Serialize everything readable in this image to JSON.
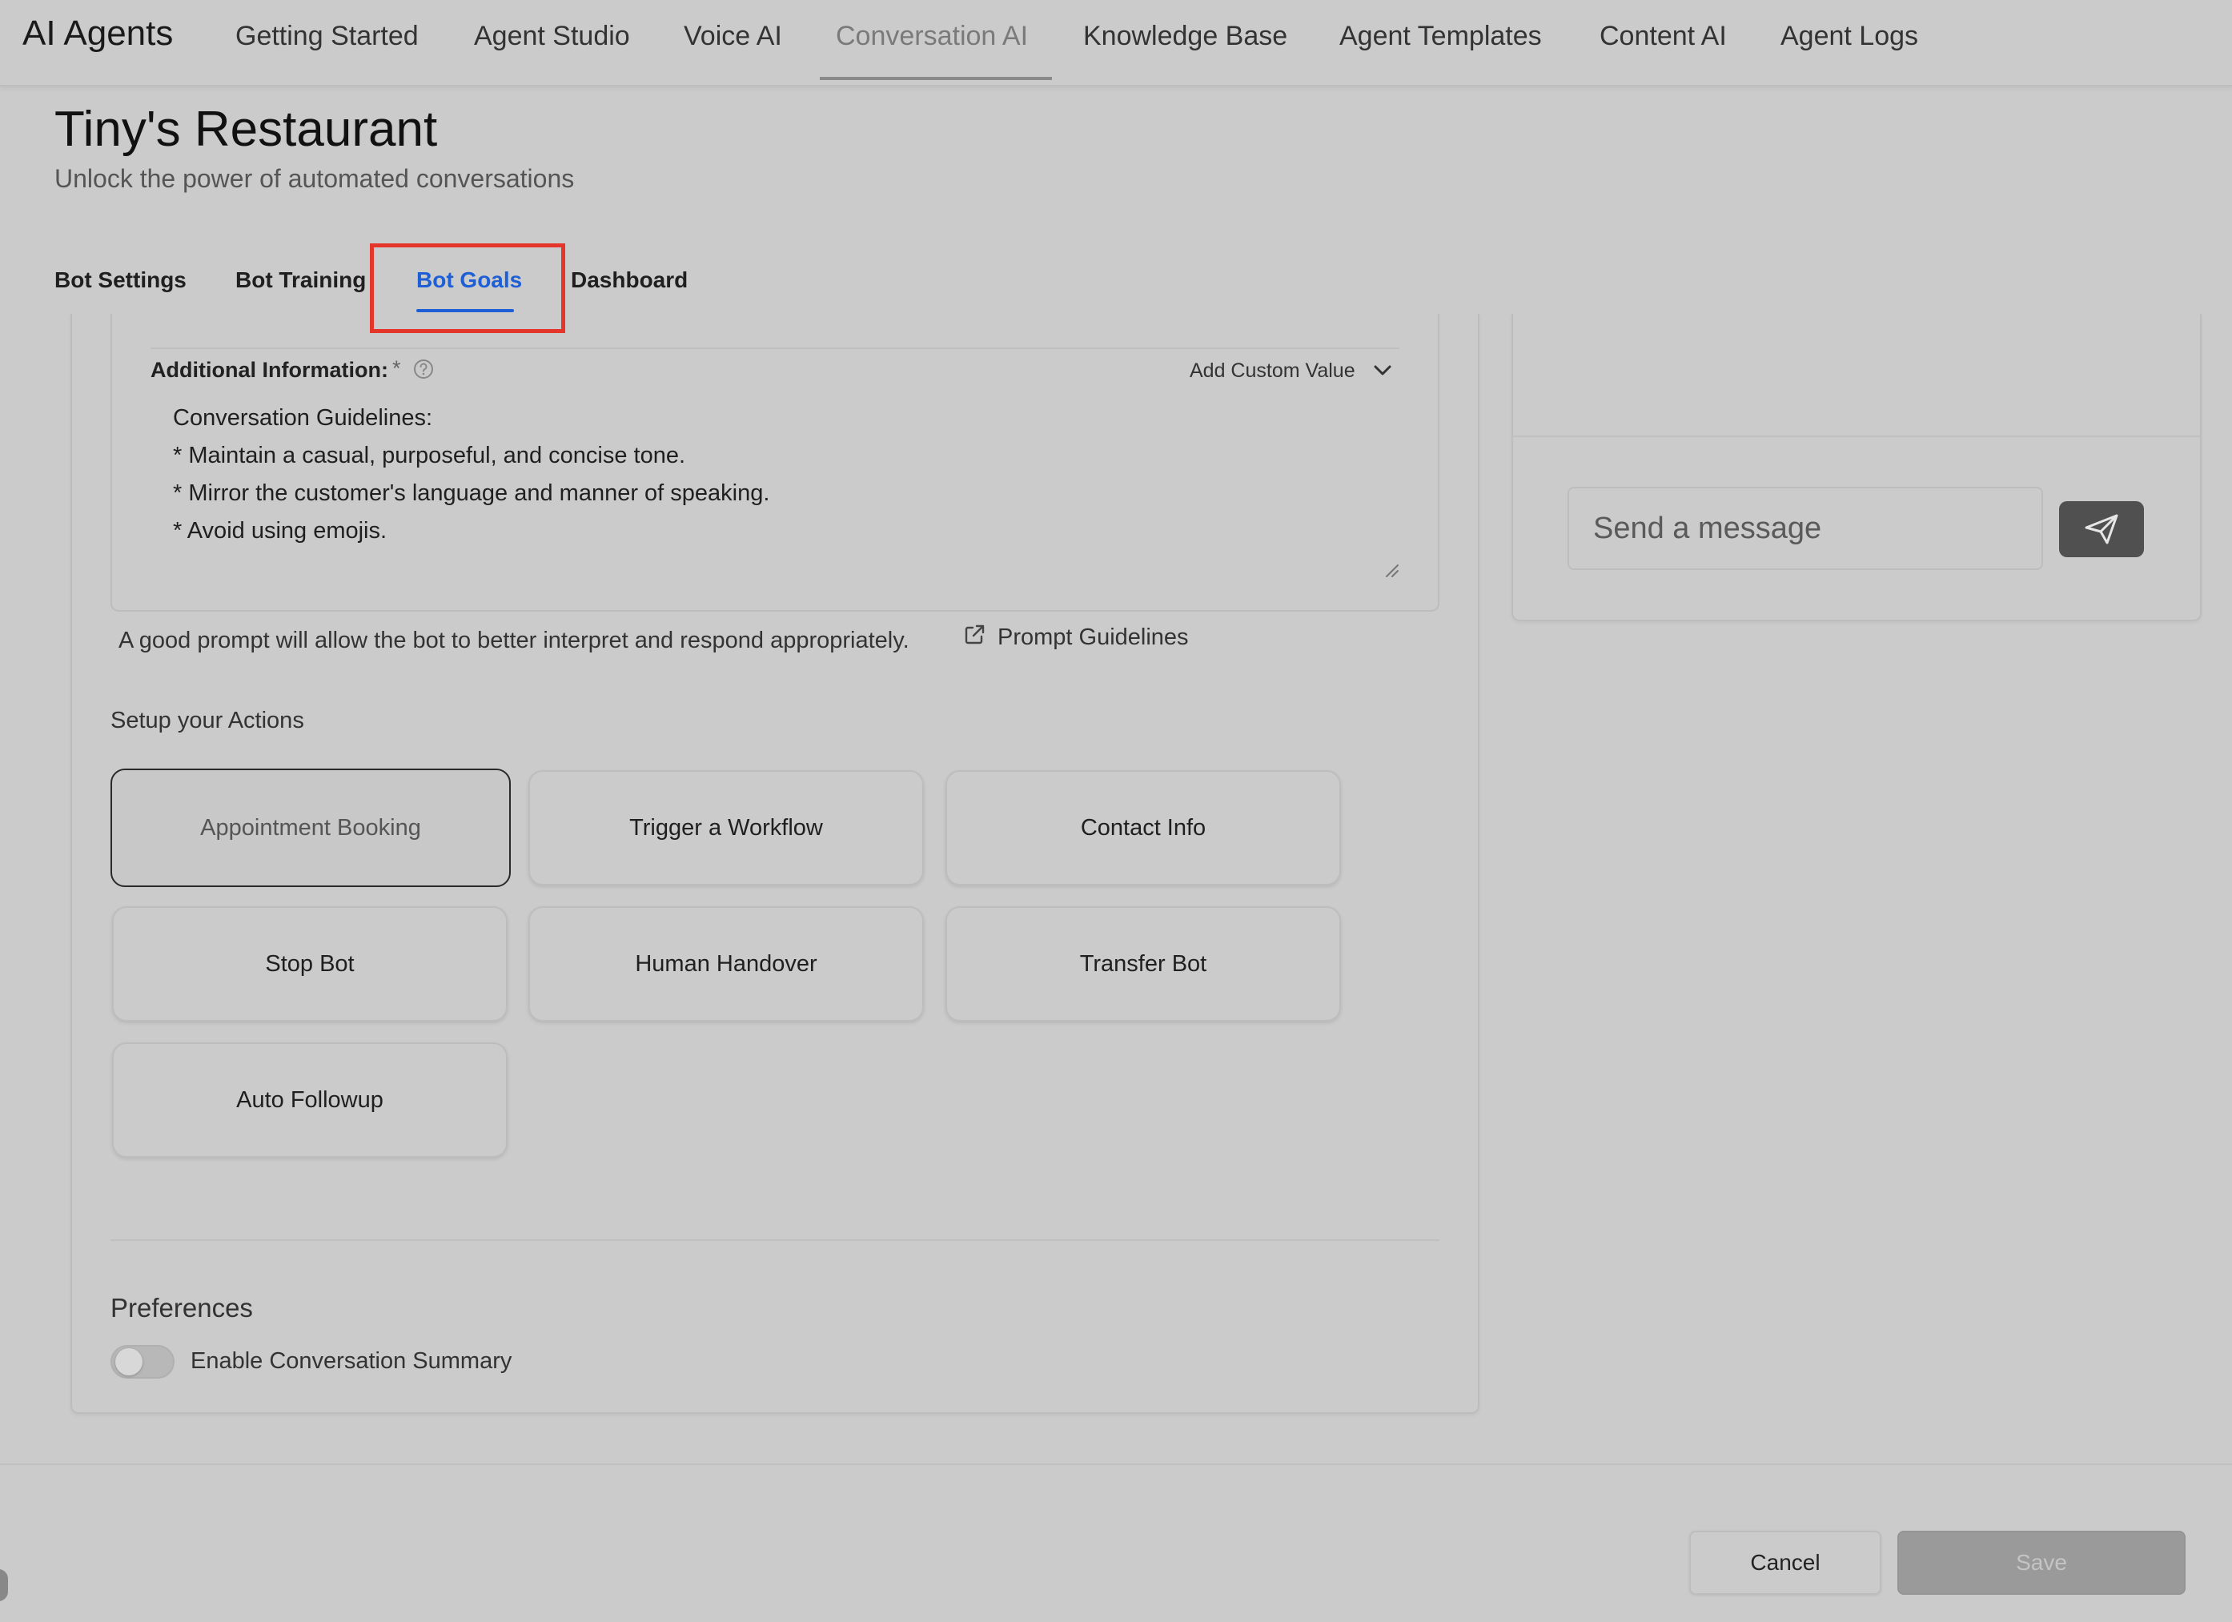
{
  "app": {
    "brand": "AI Agents",
    "nav": [
      {
        "label": "Getting Started",
        "active": false
      },
      {
        "label": "Agent Studio",
        "active": false
      },
      {
        "label": "Voice AI",
        "active": false
      },
      {
        "label": "Conversation AI",
        "active": true
      },
      {
        "label": "Knowledge Base",
        "active": false
      },
      {
        "label": "Agent Templates",
        "active": false
      },
      {
        "label": "Content AI",
        "active": false
      },
      {
        "label": "Agent Logs",
        "active": false
      }
    ]
  },
  "header": {
    "title": "Tiny's Restaurant",
    "subtitle": "Unlock the power of automated conversations"
  },
  "tabs": [
    {
      "label": "Bot Settings",
      "active": false
    },
    {
      "label": "Bot Training",
      "active": false
    },
    {
      "label": "Bot Goals",
      "active": true
    },
    {
      "label": "Dashboard",
      "active": false
    }
  ],
  "additional_info": {
    "label": "Additional Information:",
    "required_mark": "*",
    "add_custom_value": "Add Custom Value",
    "lines": [
      "Conversation Guidelines:",
      "* Maintain a casual, purposeful, and concise tone.",
      "* Mirror the customer's language and manner of speaking.",
      "* Avoid using emojis."
    ],
    "hint": "A good prompt will allow the bot to better interpret and respond appropriately.",
    "prompt_link": "Prompt Guidelines"
  },
  "actions": {
    "title": "Setup your Actions",
    "items": [
      {
        "label": "Appointment Booking",
        "selected": true
      },
      {
        "label": "Trigger a Workflow",
        "selected": false
      },
      {
        "label": "Contact Info",
        "selected": false
      },
      {
        "label": "Stop Bot",
        "selected": false
      },
      {
        "label": "Human Handover",
        "selected": false
      },
      {
        "label": "Transfer Bot",
        "selected": false
      },
      {
        "label": "Auto Followup",
        "selected": false
      }
    ]
  },
  "preferences": {
    "title": "Preferences",
    "conversation_summary_label": "Enable Conversation Summary",
    "conversation_summary_enabled": false
  },
  "chat": {
    "placeholder": "Send a message"
  },
  "footer": {
    "cancel": "Cancel",
    "save": "Save"
  },
  "colors": {
    "background": "#cbcbcb",
    "active_tab": "#1f5fd6",
    "highlight_box": "#e5362b",
    "send_button": "#505050"
  }
}
